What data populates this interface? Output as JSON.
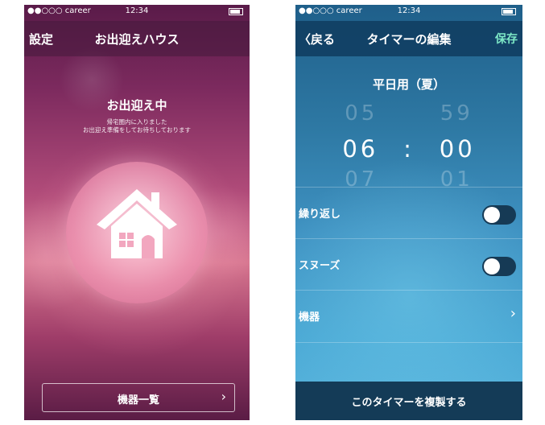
{
  "left_screen": {
    "status_bar": {
      "carrier": "●●○○○ career",
      "time": "12:34"
    },
    "nav": {
      "settings": "設定",
      "title": "お出迎えハウス"
    },
    "status_title": "お出迎え中",
    "status_lines": [
      "帰宅圏内に入りました",
      "お出迎え準備をしてお待ちしております"
    ],
    "device_list_button": "機器一覧",
    "chevron": "›"
  },
  "right_screen": {
    "status_bar": {
      "carrier": "●●○○○ career",
      "time": "12:34"
    },
    "nav": {
      "back": "〈戻る",
      "title": "タイマーの編集",
      "save": "保存"
    },
    "timer_name": "平日用（夏）",
    "picker": {
      "hour_prev": "05",
      "minute_prev": "59",
      "hour": "06",
      "separator": ":",
      "minute": "00",
      "hour_next": "07",
      "minute_next": "01"
    },
    "rows": [
      {
        "label": "繰り返し",
        "type": "toggle",
        "on": false
      },
      {
        "label": "スヌーズ",
        "type": "toggle",
        "on": false
      },
      {
        "label": "機器",
        "type": "link",
        "chevron": "›"
      }
    ],
    "duplicate_button": "このタイマーを複製する"
  },
  "colors": {
    "save_accent": "#7de8c6",
    "left_bg": "#7c2a5e",
    "right_bg": "#2e79a4"
  }
}
